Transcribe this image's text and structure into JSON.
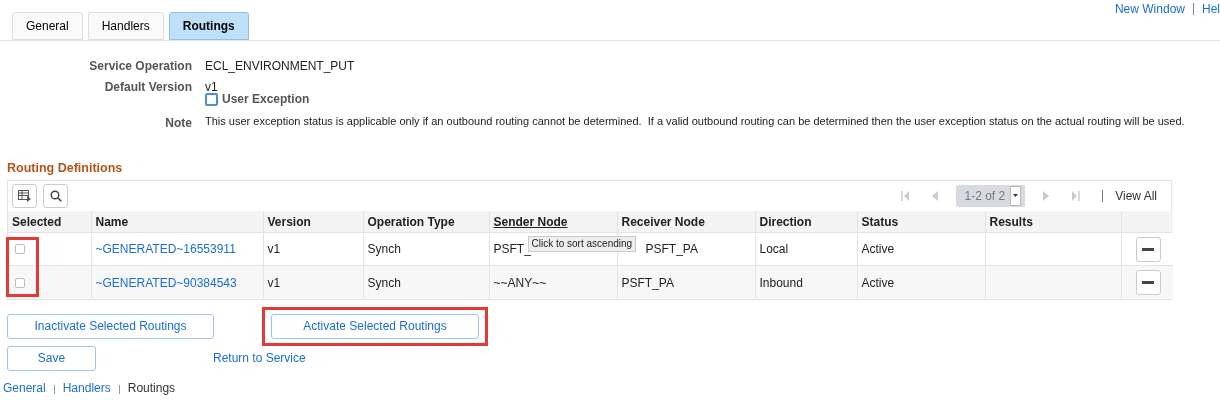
{
  "header_links": [
    "New Window",
    "Hel"
  ],
  "tabs": [
    {
      "label": "General",
      "selected": false
    },
    {
      "label": "Handlers",
      "selected": false
    },
    {
      "label": "Routings",
      "selected": true
    }
  ],
  "form": {
    "service_operation": {
      "label": "Service Operation",
      "value": "ECL_ENVIRONMENT_PUT"
    },
    "default_version": {
      "label": "Default Version",
      "value": "v1"
    },
    "user_exception": {
      "label": "User Exception",
      "checked": false
    },
    "note": {
      "label": "Note",
      "text": "This user exception status is applicable only if an outbound routing cannot be determined.  If a valid outbound routing can be determined then the user exception status on the actual routing will be used."
    }
  },
  "grid": {
    "title": "Routing Definitions",
    "pager": "1-2 of 2",
    "view_all": "View All",
    "columns": [
      {
        "label": "Selected",
        "sortable": false
      },
      {
        "label": "Name",
        "sortable": false
      },
      {
        "label": "Version",
        "sortable": false
      },
      {
        "label": "Operation Type",
        "sortable": false
      },
      {
        "label": "Sender Node",
        "sortable": true
      },
      {
        "label": "Receiver Node",
        "sortable": false
      },
      {
        "label": "Direction",
        "sortable": false
      },
      {
        "label": "Status",
        "sortable": false
      },
      {
        "label": "Results",
        "sortable": false
      }
    ],
    "rows": [
      {
        "selected": false,
        "name": "~GENERATED~16553911",
        "version": "v1",
        "operation_type": "Synch",
        "sender_node": "PSFT_",
        "receiver_node": "PSFT_PA",
        "direction": "Local",
        "status": "Active"
      },
      {
        "selected": false,
        "name": "~GENERATED~90384543",
        "version": "v1",
        "operation_type": "Synch",
        "sender_node": "~~ANY~~",
        "receiver_node": "PSFT_PA",
        "direction": "Inbound",
        "status": "Active"
      }
    ],
    "tooltip": "Click to sort ascending"
  },
  "buttons": [
    "Inactivate Selected Routings",
    "Activate Selected Routings",
    "Save"
  ],
  "return_link": "Return to Service",
  "footer_links": [
    {
      "label": "General",
      "current": false
    },
    {
      "label": "Handlers",
      "current": false
    },
    {
      "label": "Routings",
      "current": true
    }
  ]
}
